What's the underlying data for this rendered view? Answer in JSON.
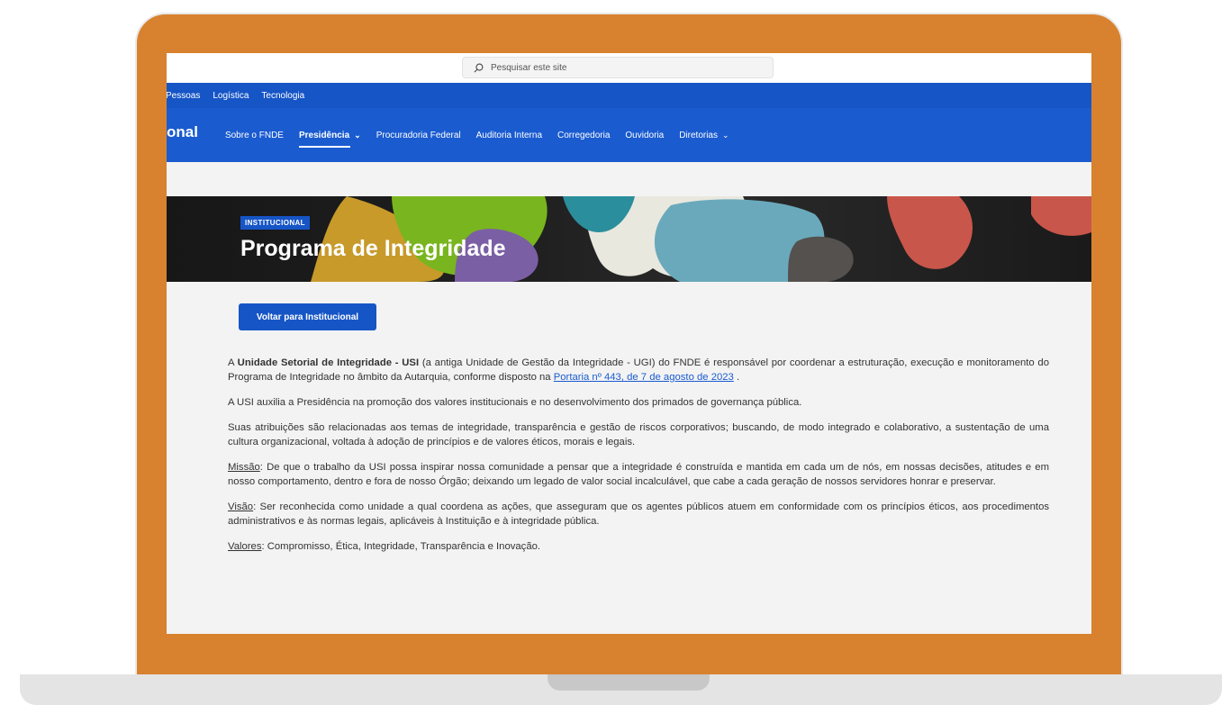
{
  "search": {
    "placeholder": "Pesquisar este site"
  },
  "subnav": {
    "items": [
      "Pessoas",
      "Logística",
      "Tecnologia"
    ]
  },
  "mainnav": {
    "site_name": "onal",
    "items": [
      {
        "label": "Sobre o FNDE",
        "active": false,
        "dropdown": false
      },
      {
        "label": "Presidência",
        "active": true,
        "dropdown": true
      },
      {
        "label": "Procuradoria Federal",
        "active": false,
        "dropdown": false
      },
      {
        "label": "Auditoria Interna",
        "active": false,
        "dropdown": false
      },
      {
        "label": "Corregedoria",
        "active": false,
        "dropdown": false
      },
      {
        "label": "Ouvidoria",
        "active": false,
        "dropdown": false
      },
      {
        "label": "Diretorias",
        "active": false,
        "dropdown": true
      }
    ]
  },
  "hero": {
    "tag": "INSTITUCIONAL",
    "title": "Programa de Integridade"
  },
  "back_button": {
    "label": "Voltar para Institucional"
  },
  "content": {
    "p1": {
      "pre": "A ",
      "bold": "Unidade Setorial de Integridade - USI",
      "mid": " (a antiga Unidade de Gestão da Integridade - UGI) do FNDE é responsável por coordenar a estruturação, execução e monitoramento do Programa de Integridade no âmbito da Autarquia, conforme disposto na ",
      "link": "Portaria nº 443, de 7 de agosto de 2023",
      "post": " ."
    },
    "p2": "A USI auxilia a Presidência na promoção dos valores institucionais e no desenvolvimento dos primados de governança pública.",
    "p3": "Suas atribuições são relacionadas aos temas de integridade, transparência e gestão de riscos corporativos; buscando, de modo integrado e colaborativo, a sustentação de uma cultura organizacional, voltada à adoção de princípios e de valores éticos, morais e legais.",
    "missao": {
      "label": "Missão",
      "text": ": De que o trabalho da USI possa inspirar nossa comunidade a pensar que a integridade é construída e mantida em cada um de nós, em nossas decisões, atitudes e em nosso comportamento, dentro e fora de nosso Órgão; deixando um legado de valor social incalculável, que cabe a cada geração de nossos servidores honrar e preservar."
    },
    "visao": {
      "label": "Visão",
      "text": ": Ser reconhecida como unidade a qual coordena as ações, que asseguram que os agentes públicos atuem em conformidade com os princípios éticos, aos procedimentos administrativos e às normas legais, aplicáveis à Instituição e à integridade pública."
    },
    "valores": {
      "label": "Valores",
      "text": ": Compromisso, Ética, Integridade, Transparência e Inovação."
    }
  },
  "colors": {
    "frame": "#d8822f",
    "primary": "#1655c6",
    "nav": "#1a5bd0"
  }
}
